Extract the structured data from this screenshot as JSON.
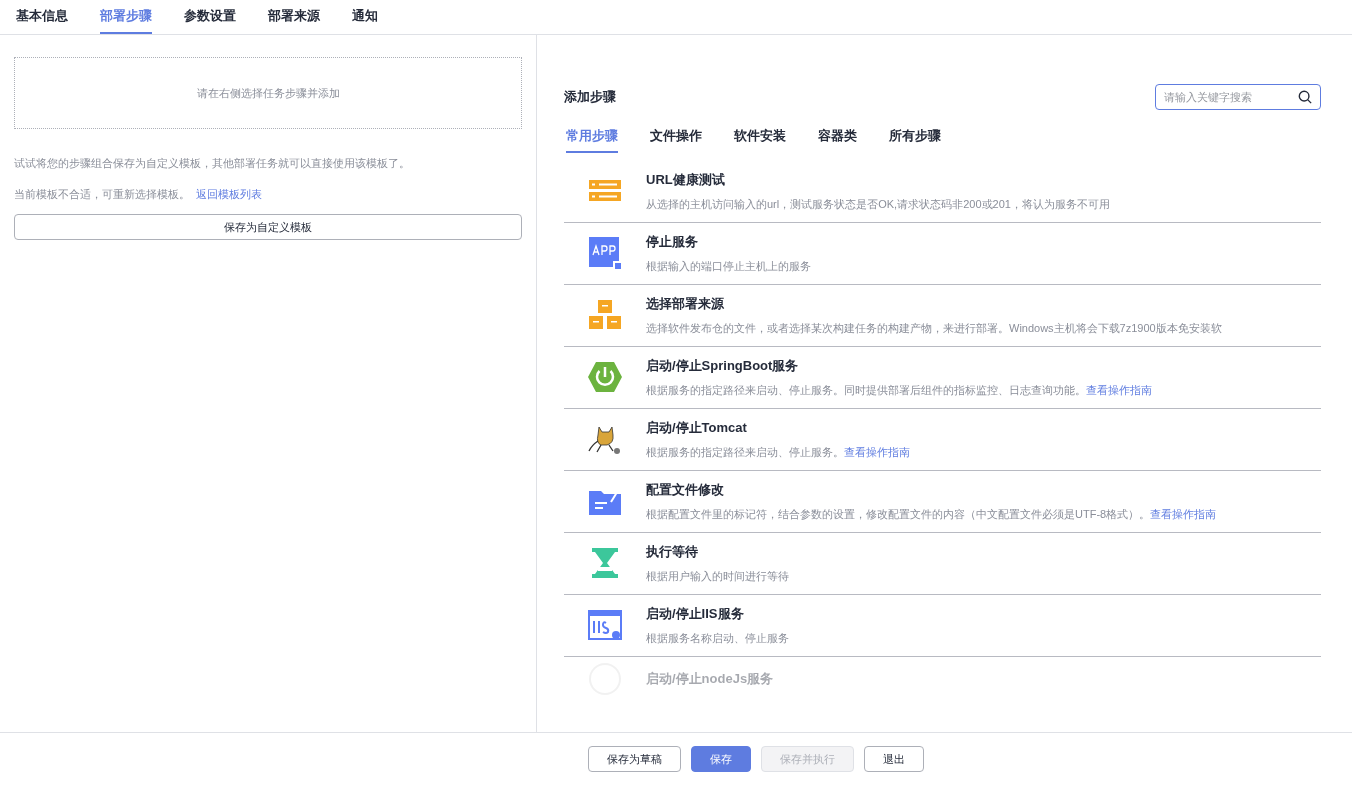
{
  "tabs": [
    {
      "label": "基本信息",
      "selected": false
    },
    {
      "label": "部署步骤",
      "selected": true
    },
    {
      "label": "参数设置",
      "selected": false
    },
    {
      "label": "部署来源",
      "selected": false
    },
    {
      "label": "通知",
      "selected": false
    }
  ],
  "left": {
    "dropzone": "请在右侧选择任务步骤并添加",
    "hint": "试试将您的步骤组合保存为自定义模板，其他部署任务就可以直接使用该模板了。",
    "template_note": "当前模板不合适，可重新选择模板。",
    "template_link": "返回模板列表",
    "save_template": "保存为自定义模板"
  },
  "right": {
    "title": "添加步骤",
    "search": {
      "placeholder": "请输入关键字搜索"
    },
    "categories": [
      {
        "label": "常用步骤",
        "selected": true
      },
      {
        "label": "文件操作",
        "selected": false
      },
      {
        "label": "软件安装",
        "selected": false
      },
      {
        "label": "容器类",
        "selected": false
      },
      {
        "label": "所有步骤",
        "selected": false
      }
    ],
    "steps": [
      {
        "kind": "server",
        "title": "URL健康测试",
        "description": "从选择的主机访问输入的url，测试服务状态是否OK,请求状态码非200或201，将认为服务不可用"
      },
      {
        "kind": "app",
        "title": "停止服务",
        "description": "根据输入的端口停止主机上的服务"
      },
      {
        "kind": "boxes",
        "title": "选择部署来源",
        "description": "选择软件发布仓的文件，或者选择某次构建任务的构建产物，来进行部署。Windows主机将会下载7z1900版本免安装软"
      },
      {
        "kind": "power",
        "title": "启动/停止SpringBoot服务",
        "description": "根据服务的指定路径来启动、停止服务。同时提供部署后组件的指标监控、日志查询功能。",
        "link": "查看操作指南"
      },
      {
        "kind": "cat",
        "title": "启动/停止Tomcat",
        "description": "根据服务的指定路径来启动、停止服务。",
        "link": "查看操作指南"
      },
      {
        "kind": "folder",
        "title": "配置文件修改",
        "description": "根据配置文件里的标记符，结合参数的设置，修改配置文件的内容（中文配置文件必须是UTF-8格式）。",
        "link": "查看操作指南"
      },
      {
        "kind": "hourglass",
        "title": "执行等待",
        "description": "根据用户输入的时间进行等待"
      },
      {
        "kind": "iis",
        "title": "启动/停止IIS服务",
        "description": "根据服务名称启动、停止服务"
      },
      {
        "kind": "node",
        "title": "启动/停止nodeJs服务"
      }
    ]
  },
  "footer": [
    {
      "label": "保存为草稿",
      "kind": "default",
      "disabled": false
    },
    {
      "label": "保存",
      "kind": "primary",
      "disabled": false
    },
    {
      "label": "保存并执行",
      "kind": "default",
      "disabled": true
    },
    {
      "label": "退出",
      "kind": "default",
      "disabled": false
    }
  ]
}
